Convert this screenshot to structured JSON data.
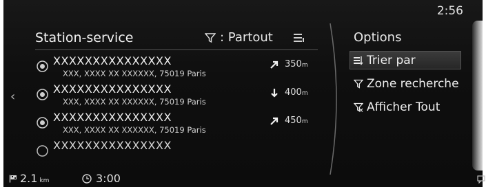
{
  "status": {
    "clock": "2:56"
  },
  "panel": {
    "title": "Station-service",
    "filter_label": ": Partout",
    "back_icon": "chevron-left-icon"
  },
  "results": [
    {
      "name": "XXXXXXXXXXXXXXX",
      "address": "XXX, XXXX XX XXXXXX, 75019 Paris",
      "distance": "350",
      "unit": "m",
      "direction": "up-right"
    },
    {
      "name": "XXXXXXXXXXXXXXX",
      "address": "XXX, XXXX XX XXXXXX, 75019 Paris",
      "distance": "400",
      "unit": "m",
      "direction": "down"
    },
    {
      "name": "XXXXXXXXXXXXXXX",
      "address": "XXX, XXXX XX XXXXXX, 75019 Paris",
      "distance": "450",
      "unit": "m",
      "direction": "up-right"
    },
    {
      "name": "XXXXXXXXXXXXXXX"
    }
  ],
  "options": {
    "title": "Options",
    "items": [
      {
        "label": "Trier par",
        "icon": "sort-icon",
        "selected": true
      },
      {
        "label": "Zone recherche",
        "icon": "filter-icon",
        "selected": false
      },
      {
        "label": "Afficher Tout",
        "icon": "filter-clear-icon",
        "selected": false
      }
    ]
  },
  "bottom_bar": {
    "distance_value": "2.1",
    "distance_unit": "km",
    "time": "3:00"
  },
  "colors": {
    "background": "#0c0c0c",
    "text": "#e6e6e6",
    "highlight": "#333333"
  }
}
